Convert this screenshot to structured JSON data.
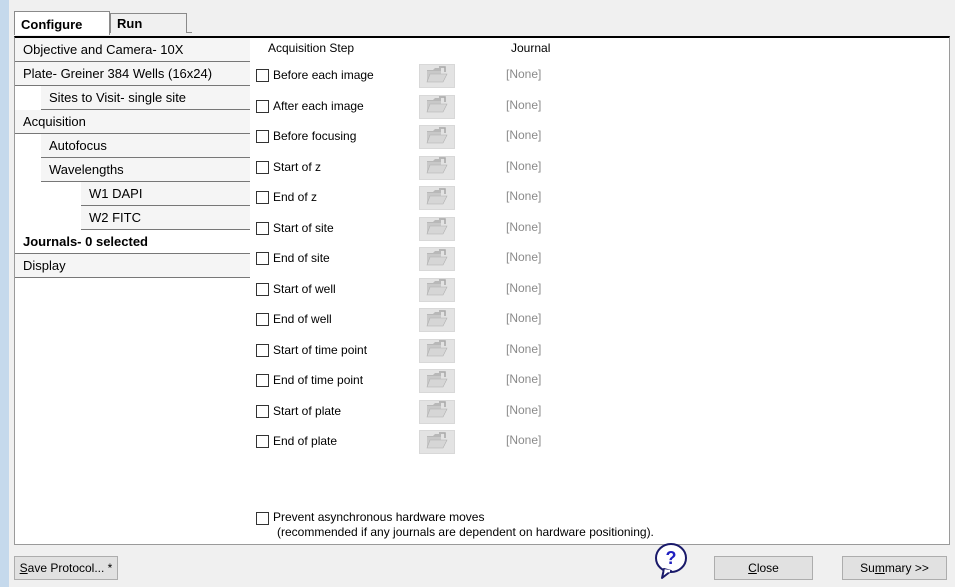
{
  "tabs": [
    {
      "label": "Configure",
      "active": true
    },
    {
      "label": "Run",
      "active": false
    }
  ],
  "nav": [
    {
      "label": "Objective and Camera- 10X"
    },
    {
      "label": "Plate- Greiner 384 Wells (16x24)"
    },
    {
      "label": "Sites to Visit- single site"
    },
    {
      "label": "Acquisition"
    },
    {
      "label": "Autofocus"
    },
    {
      "label": "Wavelengths"
    },
    {
      "label": "W1 DAPI"
    },
    {
      "label": "W2 FITC"
    },
    {
      "label": "Journals- 0 selected",
      "selected": true
    },
    {
      "label": "Display"
    }
  ],
  "table": {
    "header_step": "Acquisition Step",
    "header_journal": "Journal",
    "rows": [
      {
        "label": "Before each image",
        "checked": false,
        "journal": "[None]"
      },
      {
        "label": "After each image",
        "checked": false,
        "journal": "[None]"
      },
      {
        "label": "Before focusing",
        "checked": false,
        "journal": "[None]"
      },
      {
        "label": "Start of z",
        "checked": false,
        "journal": "[None]"
      },
      {
        "label": "End of z",
        "checked": false,
        "journal": "[None]"
      },
      {
        "label": "Start of site",
        "checked": false,
        "journal": "[None]"
      },
      {
        "label": "End of site",
        "checked": false,
        "journal": "[None]"
      },
      {
        "label": "Start of well",
        "checked": false,
        "journal": "[None]"
      },
      {
        "label": "End of well",
        "checked": false,
        "journal": "[None]"
      },
      {
        "label": "Start of time point",
        "checked": false,
        "journal": "[None]"
      },
      {
        "label": "End of time point",
        "checked": false,
        "journal": "[None]"
      },
      {
        "label": "Start of plate",
        "checked": false,
        "journal": "[None]"
      },
      {
        "label": "End of plate",
        "checked": false,
        "journal": "[None]"
      }
    ]
  },
  "async": {
    "checked": false,
    "line1": "Prevent asynchronous hardware moves",
    "line2": "(recommended if any journals are dependent on hardware positioning)."
  },
  "buttons": {
    "save": "Save Protocol... *",
    "close": "Close",
    "summary": "Summary >>"
  },
  "icons": {
    "folder": "folder-open-icon",
    "help": "help-balloon-icon"
  }
}
